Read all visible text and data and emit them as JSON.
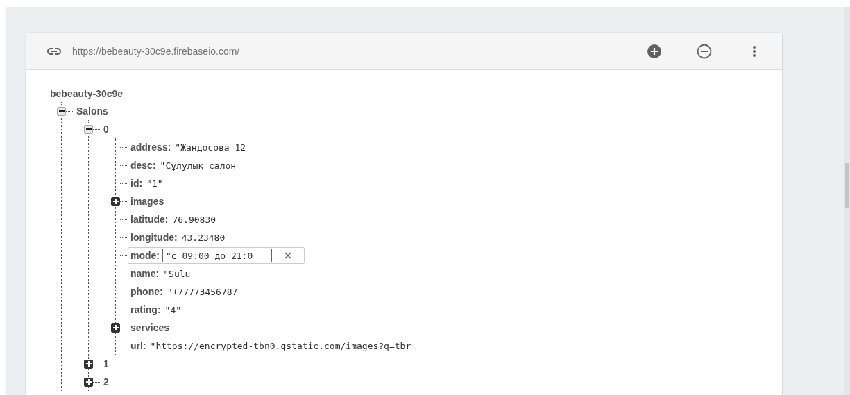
{
  "toolbar": {
    "url": "https://bebeauty-30c9e.firebaseio.com/"
  },
  "tree": {
    "key": "bebeauty-30c9e",
    "children": [
      {
        "key": "Salons",
        "kind": "branch",
        "expanded": true,
        "children": [
          {
            "key": "0",
            "kind": "branch",
            "expanded": true,
            "children": [
              {
                "key": "address:",
                "kind": "leaf",
                "value": "\"Жандосова 12"
              },
              {
                "key": "desc:",
                "kind": "leaf",
                "value": "\"Сұлулық салон"
              },
              {
                "key": "id:",
                "kind": "leaf",
                "value": "\"1\""
              },
              {
                "key": "images",
                "kind": "branch",
                "expanded": false
              },
              {
                "key": "latitude:",
                "kind": "leaf",
                "value": "76.90830"
              },
              {
                "key": "longitude:",
                "kind": "leaf",
                "value": "43.23480"
              },
              {
                "key": "mode:",
                "kind": "edit",
                "value": "\"с 09:00 до 21:0"
              },
              {
                "key": "name:",
                "kind": "leaf",
                "value": "\"Sulu"
              },
              {
                "key": "phone:",
                "kind": "leaf",
                "value": "\"+77773456787"
              },
              {
                "key": "rating:",
                "kind": "leaf",
                "value": "\"4\""
              },
              {
                "key": "services",
                "kind": "branch",
                "expanded": false
              },
              {
                "key": "url:",
                "kind": "leaf",
                "value": "\"https://encrypted-tbn0.gstatic.com/images?q=tbr"
              }
            ]
          },
          {
            "key": "1",
            "kind": "branch",
            "expanded": false
          },
          {
            "key": "2",
            "kind": "branch",
            "expanded": false
          }
        ]
      }
    ]
  }
}
